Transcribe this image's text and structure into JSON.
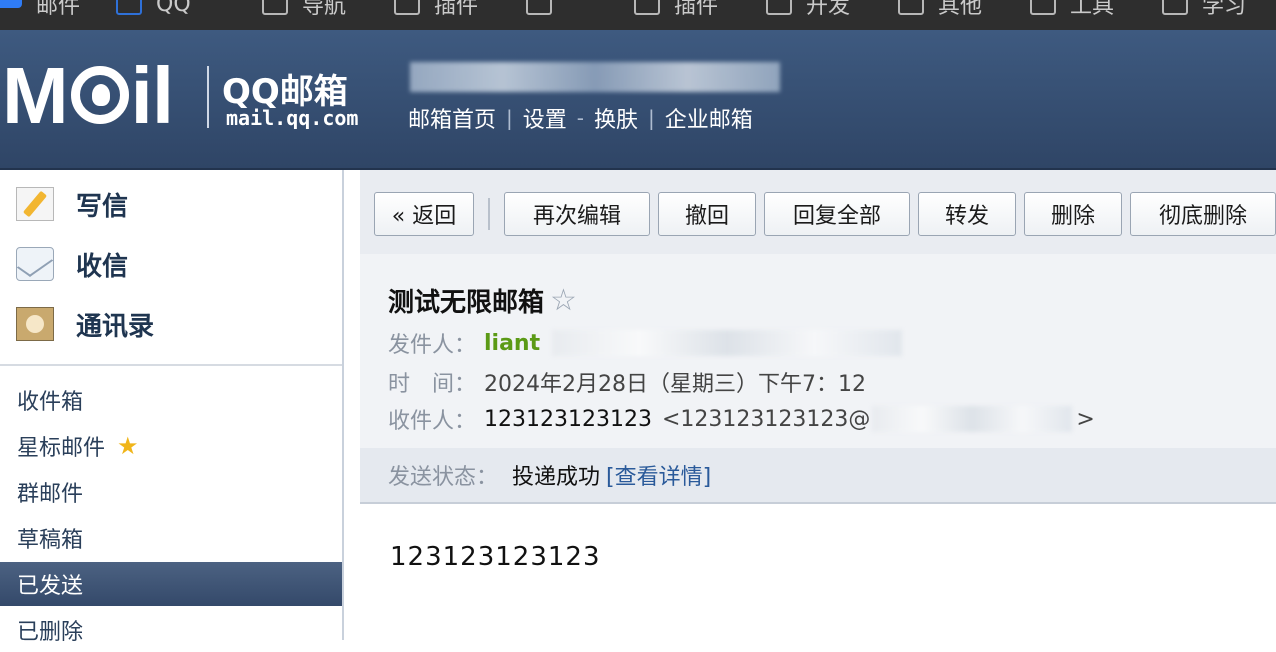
{
  "bookmarks": {
    "items": [
      "邮件",
      "QQ",
      "导航",
      "插件",
      "",
      "插件",
      "开发",
      "其他",
      "工具",
      "学习"
    ]
  },
  "header": {
    "logo_text": "Mail",
    "brand": "QQ邮箱",
    "domain": "mail.qq.com",
    "links": [
      "邮箱首页",
      "设置",
      "换肤",
      "企业邮箱"
    ],
    "separators": [
      "|",
      "-",
      "|"
    ],
    "colors": {
      "background": "#34496a",
      "text": "#ffffff"
    }
  },
  "sidebar": {
    "quick_actions": [
      {
        "label": "写信",
        "icon": "write-icon"
      },
      {
        "label": "收信",
        "icon": "inbox-icon"
      },
      {
        "label": "通讯录",
        "icon": "contacts-icon"
      }
    ],
    "folders": [
      {
        "label": "收件箱"
      },
      {
        "label": "星标邮件",
        "icon": "star-icon"
      },
      {
        "label": "群邮件"
      },
      {
        "label": "草稿箱"
      },
      {
        "label": "已发送",
        "active": true
      },
      {
        "label": "已删除"
      }
    ],
    "active_color": "#3f5577"
  },
  "toolbar": {
    "back": "« 返回",
    "edit_again": "再次编辑",
    "recall": "撤回",
    "reply_all": "回复全部",
    "forward": "转发",
    "delete": "删除",
    "delete_permanently": "彻底删除"
  },
  "email": {
    "subject": "测试无限邮箱",
    "star": "☆",
    "sender_label": "发件人：",
    "sender_name": "liant",
    "time_label": "时　间：",
    "time_value": "2024年2月28日（星期三）下午7：12",
    "recipient_label": "收件人：",
    "recipient_name": "123123123123",
    "recipient_email": "<123123123123@",
    "recipient_email_end": ">",
    "status_label": "发送状态：",
    "status_value": "投递成功",
    "status_link": "[查看详情]",
    "body": "123123123123",
    "colors": {
      "sender": "#5b9a16",
      "link": "#2a5a9a"
    }
  }
}
